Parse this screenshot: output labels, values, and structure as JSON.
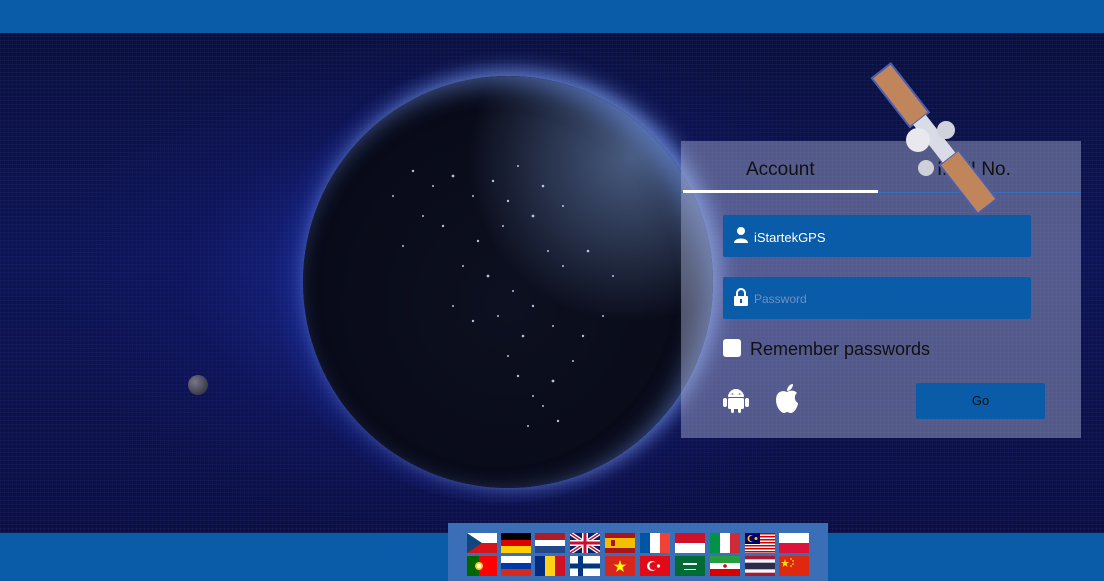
{
  "login": {
    "tabs": [
      {
        "label": "Account",
        "active": true
      },
      {
        "label": "IMEI No.",
        "active": false
      }
    ],
    "username": {
      "value": "iStartekGPS"
    },
    "password": {
      "placeholder": "Password",
      "value": ""
    },
    "remember": {
      "label": "Remember passwords",
      "checked": false
    },
    "go_label": "Go",
    "app_icons": [
      "android-icon",
      "apple-icon"
    ]
  },
  "languages": [
    "cz-flag",
    "de-flag",
    "nl-flag",
    "gb-flag",
    "es-flag",
    "fr-flag",
    "id-flag",
    "it-flag",
    "my-flag",
    "pl-flag",
    "pt-flag",
    "ru-flag",
    "ro-flag",
    "fi-flag",
    "vn-flag",
    "tr-flag",
    "sa-flag",
    "ir-flag",
    "th-flag",
    "cn-flag"
  ],
  "colors": {
    "brand": "#0a5ba8",
    "panel": "rgba(170,178,210,0.45)"
  }
}
